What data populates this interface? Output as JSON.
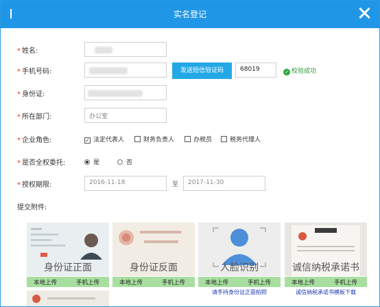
{
  "dialog": {
    "title": "实名登记"
  },
  "form": {
    "name": {
      "label": "姓名:"
    },
    "phone": {
      "label": "手机号码:",
      "send_button": "发送短信验证码",
      "code_value": "68019",
      "status": "校验成功"
    },
    "id_card": {
      "label": "身份证:"
    },
    "department": {
      "label": "所在部门:",
      "placeholder": "办公室"
    },
    "role": {
      "label": "企业角色:",
      "options": [
        "法定代表人",
        "财务负责人",
        "办税员",
        "税务代理人"
      ],
      "checked": "法定代表人"
    },
    "full_delegation": {
      "label": "是否全权委托:",
      "options": [
        "是",
        "否"
      ],
      "selected": "是"
    },
    "period": {
      "label": "授权期限:",
      "start": "2016-11-18",
      "separator": "至",
      "end": "2017-11-30"
    },
    "attachments_label": "提交附件:"
  },
  "attachments": [
    {
      "title": "身份证正面",
      "local": "本地上传",
      "phone": "手机上传",
      "note": ""
    },
    {
      "title": "身份证反面",
      "local": "本地上传",
      "phone": "手机上传",
      "note": ""
    },
    {
      "title": "人脸识别",
      "local": "本地上传",
      "phone": "手机上传",
      "note": "请手持身份证正面拍照"
    },
    {
      "title": "诚信纳税承诺书",
      "local": "本地上传",
      "phone": "手机上传",
      "note": "诚信纳税承诺书模板下载"
    }
  ],
  "icons": {
    "close": "close-icon",
    "ok": "check-circle-icon"
  },
  "colors": {
    "accent": "#1f97e6",
    "required": "#e0312b",
    "success": "#2e9a3a",
    "upload_bar": "#a8dfa0"
  }
}
